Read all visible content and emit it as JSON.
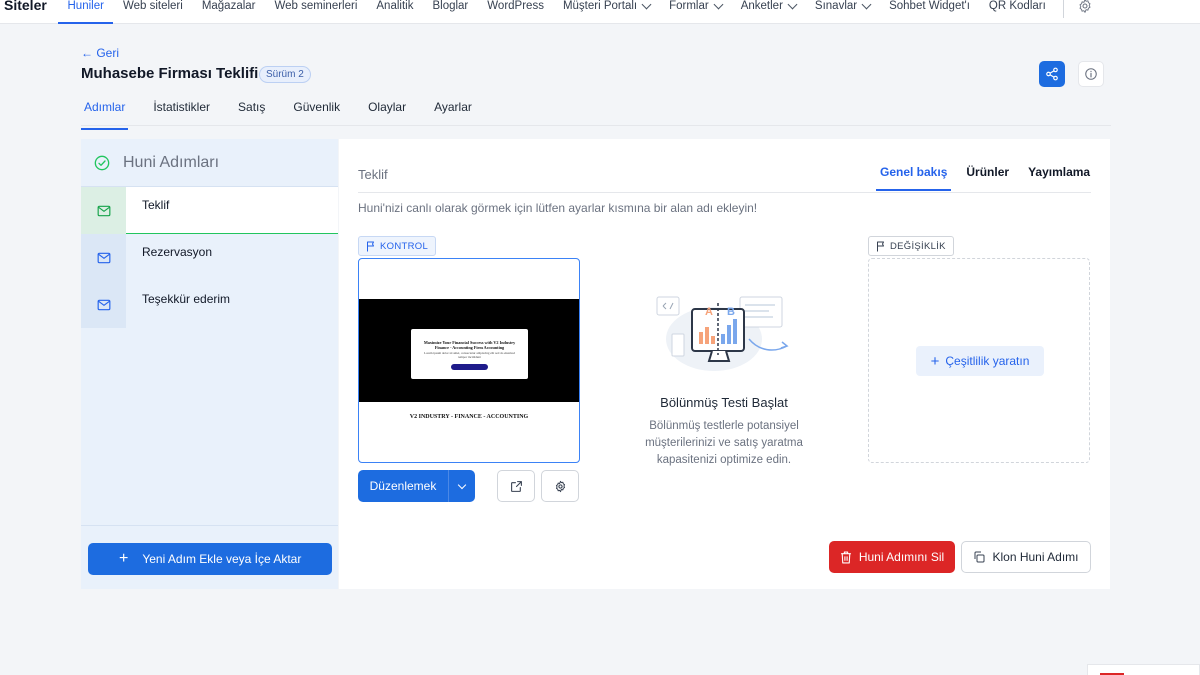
{
  "topnav": {
    "brand": "Siteler",
    "items": [
      {
        "label": "Huniler",
        "active": true,
        "dropdown": false
      },
      {
        "label": "Web siteleri",
        "dropdown": false
      },
      {
        "label": "Mağazalar",
        "dropdown": false
      },
      {
        "label": "Web seminerleri",
        "dropdown": false
      },
      {
        "label": "Analitik",
        "dropdown": false
      },
      {
        "label": "Bloglar",
        "dropdown": false
      },
      {
        "label": "WordPress",
        "dropdown": false
      },
      {
        "label": "Müşteri Portalı",
        "dropdown": true
      },
      {
        "label": "Formlar",
        "dropdown": true
      },
      {
        "label": "Anketler",
        "dropdown": true
      },
      {
        "label": "Sınavlar",
        "dropdown": true
      },
      {
        "label": "Sohbet Widget'ı",
        "dropdown": false
      },
      {
        "label": "QR Kodları",
        "dropdown": false
      }
    ],
    "settings_icon": "gear-icon"
  },
  "header": {
    "back_label": "← Geri",
    "title": "Muhasebe Firması Teklifi",
    "version": "Sürüm 2",
    "share_icon": "share-icon",
    "info_icon": "info-icon"
  },
  "tabs": [
    {
      "label": "Adımlar",
      "active": true
    },
    {
      "label": "İstatistikler"
    },
    {
      "label": "Satış"
    },
    {
      "label": "Güvenlik"
    },
    {
      "label": "Olaylar"
    },
    {
      "label": "Ayarlar"
    }
  ],
  "sidebar": {
    "title": "Huni Adımları",
    "steps": [
      {
        "label": "Teklif",
        "active": true
      },
      {
        "label": "Rezervasyon"
      },
      {
        "label": "Teşekkür ederim"
      }
    ],
    "add_button": "Yeni Adım Ekle veya İçe Aktar"
  },
  "main": {
    "step_title": "Teklif",
    "tabs": [
      {
        "label": "Genel bakış",
        "active": true
      },
      {
        "label": "Ürünler"
      },
      {
        "label": "Yayımlama"
      }
    ],
    "notice": "Huni'nizi canlı olarak görmek için lütfen ayarlar kısmına bir alan adı ekleyin!",
    "control_badge": "KONTROL",
    "variant_badge": "DEĞİŞİKLİK",
    "preview": {
      "headline": "Maximize Your Financial Success with V2 Industry Finance - Accounting Firm Accounting",
      "subtext": "Lorem ipsum dolor sit amet, consectetur adipiscing elit sed do eiusmod tempor incididunt",
      "footer": "V2 INDUSTRY - FINANCE - ACCOUNTING"
    },
    "edit_button": "Düzenlemek",
    "split_test": {
      "title": "Bölünmüş Testi Başlat",
      "description": "Bölünmüş testlerle potansiyel müşterilerinizi ve satış yaratma kapasitenizi optimize edin.",
      "label_a": "A",
      "label_b": "B"
    },
    "create_variation": "Çeşitlilik yaratın",
    "delete_button": "Huni Adımını Sil",
    "clone_button": "Klon Huni Adımı"
  },
  "colors": {
    "primary": "#1d6ce0",
    "danger": "#dc2626",
    "success": "#22c55e",
    "sidebar_bg": "#e9f1fb"
  }
}
